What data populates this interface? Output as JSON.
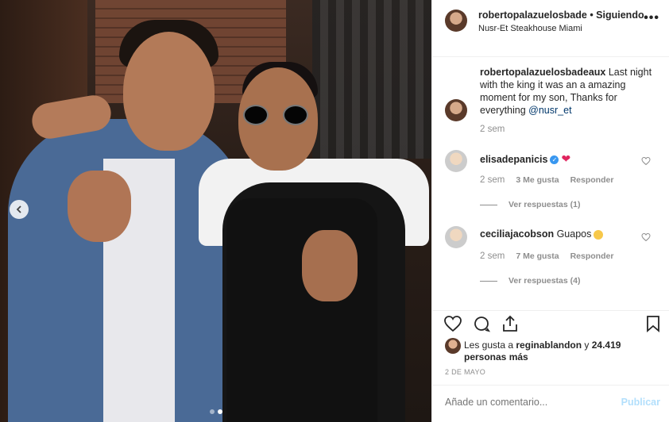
{
  "post": {
    "carousel_prev_icon": "chevron-left-icon",
    "dots_count": 2,
    "active_dot": 1
  },
  "header": {
    "username": "robertopalazuelosbade",
    "separator": " • ",
    "follow_status": "Siguiendo",
    "location": "Nusr-Et Steakhouse Miami",
    "more_icon": "•••"
  },
  "caption": {
    "username": "robertopalazuelosbadeaux",
    "text": " Last night with the king it was an a amazing moment for my son, Thanks for everything ",
    "mention": "@nusr_et",
    "time": "2 sem"
  },
  "comments": [
    {
      "username": "elisadepanicis",
      "verified": true,
      "emoji": "heart",
      "text": "",
      "time": "2 sem",
      "likes": "3 Me gusta",
      "reply_label": "Responder",
      "view_replies": "Ver respuestas (1)"
    },
    {
      "username": "ceciliajacobson",
      "verified": false,
      "emoji": "heart-eyes",
      "text": " Guapos",
      "time": "2 sem",
      "likes": "7 Me gusta",
      "reply_label": "Responder",
      "view_replies": "Ver respuestas (4)"
    }
  ],
  "actions": {
    "like_icon": "heart-icon",
    "comment_icon": "comment-icon",
    "share_icon": "share-icon",
    "save_icon": "bookmark-icon"
  },
  "likes": {
    "prefix": "Les gusta a ",
    "user": "reginablandon",
    "middle": " y ",
    "count": "24.419 personas más"
  },
  "date": "2 DE MAYO",
  "add_comment": {
    "placeholder": "Añade un comentario...",
    "post_label": "Publicar"
  },
  "colors": {
    "link": "#00376b",
    "muted": "#8e8e8e",
    "post_disabled": "#b2dffc",
    "verified": "#3897f0"
  }
}
